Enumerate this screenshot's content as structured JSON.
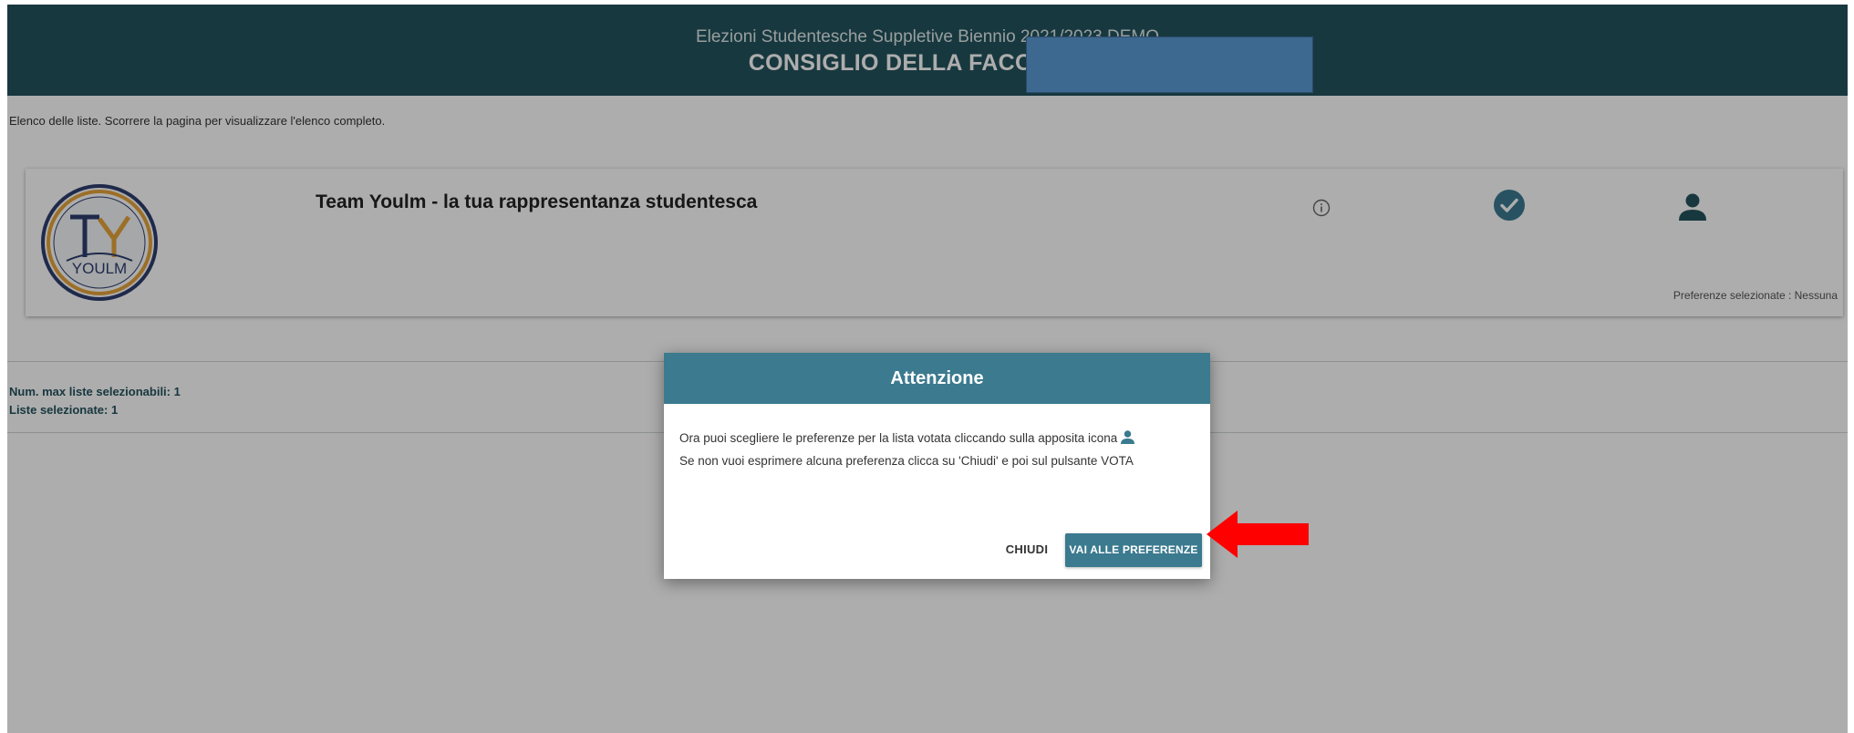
{
  "header": {
    "subtitle": "Elezioni Studentesche Suppletive Biennio 2021/2023  DEMO",
    "title": "CONSIGLIO DELLA FACOLTÀ DI"
  },
  "intro_text": "Elenco delle liste. Scorrere la pagina per visualizzare l'elenco completo.",
  "list_card": {
    "logo_text": "YOULM",
    "logo_letters": "TY",
    "name": "Team Youlm - la tua rappresentanza studentesca",
    "preferences_status": "Preferenze selezionate : Nessuna"
  },
  "counts": {
    "max_lists": "Num. max liste selezionabili: 1",
    "selected_lists": "Liste selezionate: 1"
  },
  "dialog": {
    "title": "Attenzione",
    "line1": "Ora puoi scegliere le preferenze per la lista votata cliccando sulla apposita icona",
    "line2": "Se non vuoi esprimere alcuna preferenza clicca su 'Chiudi' e poi sul pulsante VOTA",
    "close_label": "CHIUDI",
    "go_label": "VAI ALLE PREFERENZE"
  },
  "colors": {
    "header": "#24535d",
    "accent": "#3b7a8f",
    "arrow": "#ff0000"
  },
  "icons": [
    "info-icon",
    "check-circle-icon",
    "user-icon",
    "red-arrow-icon"
  ]
}
